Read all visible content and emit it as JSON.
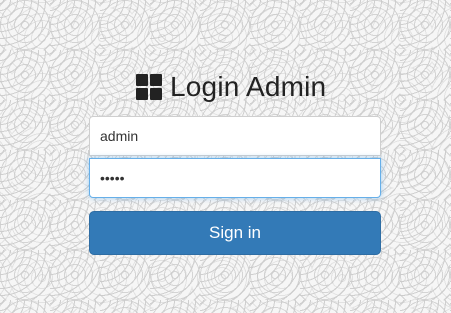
{
  "page": {
    "title": "Login Admin",
    "title_icon": "dashboard-grid-icon"
  },
  "form": {
    "username_value": "admin",
    "password_value": "•••••",
    "submit_label": "Sign in"
  },
  "colors": {
    "primary": "#337ab7",
    "focus_border": "#66afe9",
    "background": "#f6f6f6"
  }
}
